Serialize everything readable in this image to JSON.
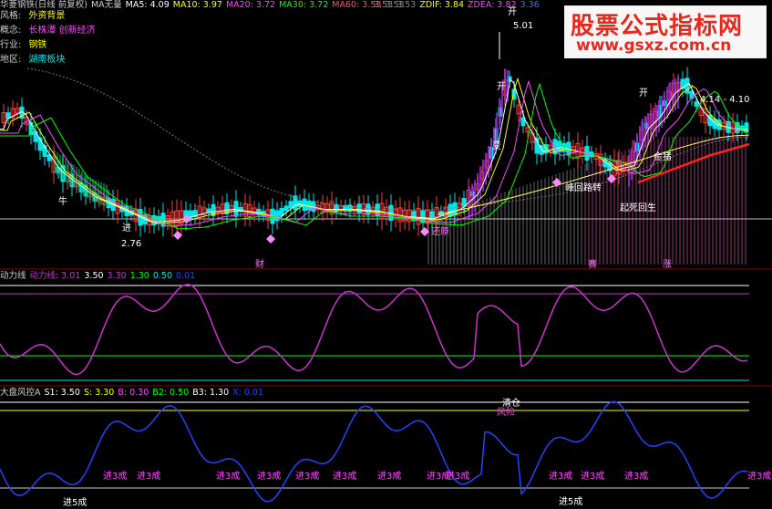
{
  "header": {
    "title": "华菱钢铁(日线 前复权)",
    "ma_label": "MA无量",
    "ma5": "MA5: 4.09",
    "ma10": "MA10: 3.97",
    "ma20": "MA20: 3.72",
    "ma30": "MA30: 3.72",
    "ma60": "MA60: 3.53",
    "extra1": "3.53",
    "extra2": "3.53",
    "extra3": "3.53",
    "zdif": "ZDIF: 3.84",
    "zdea": "ZDEA: 3.82",
    "extra4": "3.36"
  },
  "info": {
    "rows": [
      {
        "key": "风格:",
        "value": "外资背景"
      },
      {
        "key": "概念:",
        "value": "长株潭 创新经济"
      },
      {
        "key": "行业:",
        "value": "钢铁"
      },
      {
        "key": "地区:",
        "value": "湖南板块"
      }
    ]
  },
  "watermark": {
    "title": "股票公式指标网",
    "url": "www.gsxz.com.cn"
  },
  "annotations": {
    "price_high": "5.01",
    "price_low": "2.76",
    "range": "4.14 - 4.10",
    "kai1": "开",
    "kai2": "开",
    "kai3": "开",
    "fengui": "峰回路转",
    "qisi": "起死回生",
    "huanyuan": "还原",
    "jinzhu": "金猪",
    "cai": "财",
    "cai2": "赛",
    "zhang": "涨",
    "bian": "变",
    "jin": "进",
    "niu": "牛"
  },
  "panel2": {
    "name": "动力线",
    "v_name": "动力线: 3.01",
    "v1": "3.50",
    "v2": "3.30",
    "v3": "1.30",
    "v4": "0.50",
    "v5": "0.01"
  },
  "panel3": {
    "name": "大盘风控A",
    "s1": "S1: 3.50",
    "s": "S: 3.30",
    "b": "B: 0.30",
    "b2": "B2: 0.50",
    "b3": "B3: 1.30",
    "x": "X: 0.01",
    "qingcang": "清仓",
    "fengxian": "风险",
    "signals": [
      "进3成",
      "进3成",
      "进3成",
      "进3成",
      "进3成",
      "进3成",
      "进3成",
      "进3成",
      "进3成",
      "进3成",
      "进3成",
      "进3成",
      "进3成"
    ],
    "bottom_signals": [
      "进5成",
      "进5成"
    ]
  },
  "colors": {
    "up": "#ff3b3b",
    "down": "#00e5e5",
    "magenta": "#cc33cc",
    "purple": "#9b2bdc",
    "yellow": "#ffff00",
    "blue": "#1f3fff"
  }
}
